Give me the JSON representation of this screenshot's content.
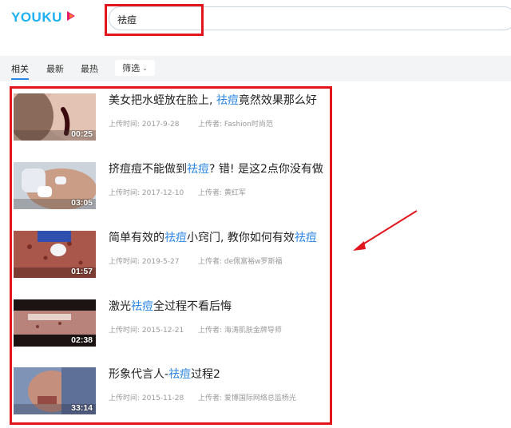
{
  "logo": {
    "text_you": "YOU",
    "text_ku": "KU",
    "mark": "play-arrow-icon"
  },
  "search": {
    "value": "祛痘",
    "placeholder": ""
  },
  "tabs": [
    {
      "label": "相关",
      "active": true
    },
    {
      "label": "最新",
      "active": false
    },
    {
      "label": "最热",
      "active": false
    }
  ],
  "filter": {
    "label": "筛选",
    "caret": "⌄"
  },
  "colors": {
    "accent": "#2b86e6",
    "highlight_box": "#e0161c",
    "brand": "#1eb0f0"
  },
  "results": [
    {
      "title_before": "美女把水蛭放在脸上, ",
      "title_keyword": "祛痘",
      "title_after": "竟然效果那么好",
      "duration": "00:25",
      "date": "上传时间: 2017-9-28",
      "uploader": "上传者: Fashion时尚范"
    },
    {
      "title_before": "挤痘痘不能做到",
      "title_keyword": "祛痘",
      "title_after": "? 错! 是这2点你没有做",
      "duration": "03:05",
      "date": "上传时间: 2017-12-10",
      "uploader": "上传者: 黄红军"
    },
    {
      "title_before": "简单有效的",
      "title_keyword": "祛痘",
      "title_after": "小窍门, 教你如何有效",
      "title_keyword2": "祛痘",
      "duration": "01:57",
      "date": "上传时间: 2019-5-27",
      "uploader": "上传者: de佩富裕w罗斯福"
    },
    {
      "title_before": "激光",
      "title_keyword": "祛痘",
      "title_after": "全过程不看后悔",
      "duration": "02:38",
      "date": "上传时间: 2015-12-21",
      "uploader": "上传者: 海涛肌肤金牌导师"
    },
    {
      "title_before": "形象代言人-",
      "title_keyword": "祛痘",
      "title_after": "过程2",
      "duration": "33:14",
      "date": "上传时间: 2015-11-28",
      "uploader": "上传者: 爱博国际网络总监杨光"
    }
  ]
}
